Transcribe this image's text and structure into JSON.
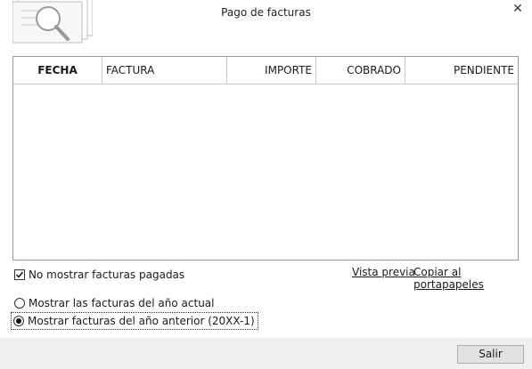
{
  "window": {
    "title": "Pago de facturas",
    "close_symbol": "✕"
  },
  "grid": {
    "columns": [
      "FECHA",
      "FACTURA",
      "IMPORTE",
      "COBRADO",
      "PENDIENTE"
    ],
    "rows": []
  },
  "options": {
    "hide_paid": {
      "label": "No mostrar facturas pagadas",
      "checked": true
    },
    "preview_link": "Vista previa",
    "copy_link": "Copiar al portapapeles",
    "radio_current": {
      "label": "Mostrar las facturas del año actual",
      "selected": false
    },
    "radio_previous": {
      "label": "Mostrar facturas del año anterior (20XX-1)",
      "selected": true
    }
  },
  "footer": {
    "exit_label": "Salir"
  },
  "icons": {
    "header": "document-search-icon",
    "close": "close-icon",
    "check": "checkmark-icon"
  }
}
